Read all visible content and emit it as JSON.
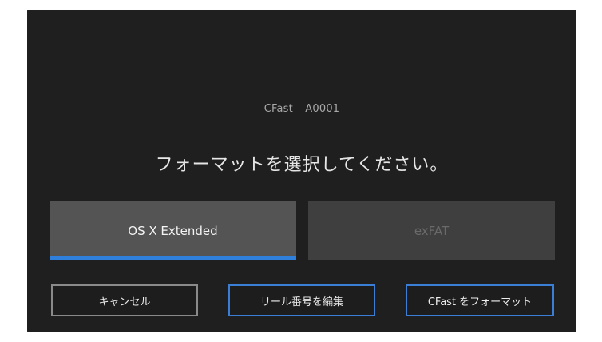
{
  "dialog": {
    "card_name": "CFast – A0001",
    "prompt": "フォーマットを選択してください。"
  },
  "format_options": [
    {
      "label": "OS X Extended",
      "selected": true
    },
    {
      "label": "exFAT",
      "selected": false
    }
  ],
  "buttons": {
    "cancel": "キャンセル",
    "edit_reel": "リール番号を編集",
    "format": "CFast をフォーマット"
  },
  "colors": {
    "background": "#1f1f1f",
    "accent": "#2f7fdc",
    "selected_option": "#545454",
    "unselected_option": "#3f3f3f"
  }
}
